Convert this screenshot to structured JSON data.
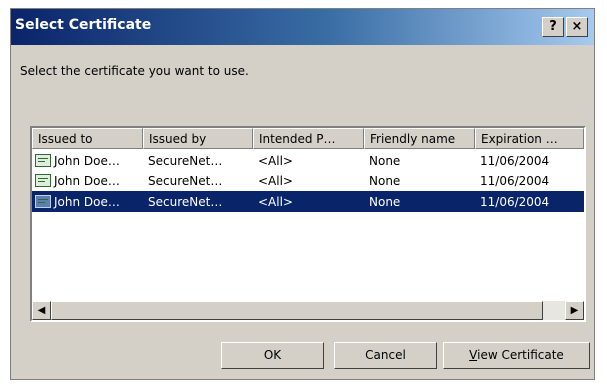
{
  "window": {
    "title": "Select Certificate",
    "help_label": "?",
    "close_label": "×"
  },
  "prompt": "Select the certificate you want to use.",
  "list": {
    "columns": [
      "Issued to",
      "Issued by",
      "Intended P…",
      "Friendly name",
      "Expiration …"
    ],
    "rows": [
      {
        "issued_to": "John Doe…",
        "issued_by": "SecureNet…",
        "intended": "<All>",
        "friendly": "None",
        "expiration": "11/06/2004",
        "selected": false
      },
      {
        "issued_to": "John Doe…",
        "issued_by": "SecureNet…",
        "intended": "<All>",
        "friendly": "None",
        "expiration": "11/06/2004",
        "selected": false
      },
      {
        "issued_to": "John Doe…",
        "issued_by": "SecureNet…",
        "intended": "<All>",
        "friendly": "None",
        "expiration": "11/06/2004",
        "selected": true
      }
    ],
    "icon": "certificate-icon"
  },
  "scrollbar": {
    "left_arrow": "◀",
    "right_arrow": "▶"
  },
  "buttons": {
    "ok": "OK",
    "cancel": "Cancel",
    "view_first": "V",
    "view_rest": "iew Certificate"
  },
  "colors": {
    "selection": "#0a246a",
    "dialog_bg": "#d4d0c8"
  }
}
